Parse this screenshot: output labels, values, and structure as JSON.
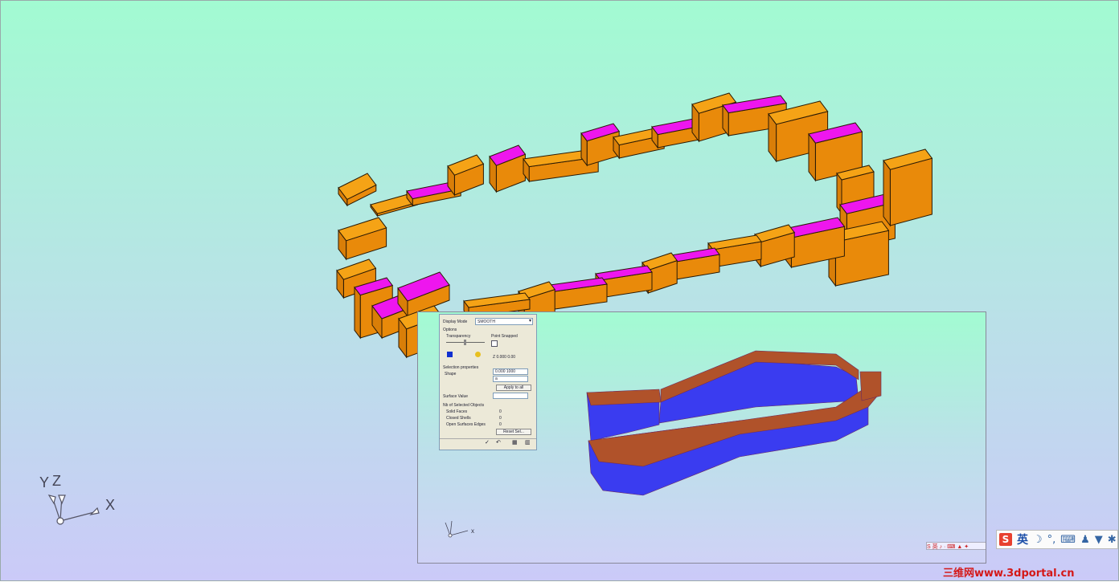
{
  "main_view": {
    "axis": {
      "x_label": "X",
      "y_label": "Y",
      "z_label": "Z"
    },
    "colors": {
      "box_orange": "#e98a0a",
      "box_orange_top": "#f5a316",
      "box_magenta_top": "#ee16ee",
      "edge": "#2a1a05"
    }
  },
  "inset": {
    "axis": {
      "x_label": "x"
    },
    "colors": {
      "wall_blue": "#3a3cf0",
      "wall_brown": "#b0522a"
    },
    "dialog": {
      "display_mode_label": "Display Mode",
      "display_mode_value": "SMOOTH",
      "options_label": "Options",
      "slider_label": "Transparency",
      "point_label": "Point Snapped",
      "coord_value": "Z  0.000  0.00",
      "selection_header": "Selection properties",
      "field1_label": "Shape",
      "field1_value": "0.000  1000",
      "field2_value": "a",
      "apply_label": "Apply to all",
      "surface_label": "Surface Value",
      "info_header": "Nb of Selected Objects",
      "info_rows": [
        {
          "label": "Solid Faces",
          "value": "0"
        },
        {
          "label": "Closed Shells",
          "value": "0"
        },
        {
          "label": "Open Surfaces Edges",
          "value": "0"
        }
      ],
      "reset_label": "Reset Sel..."
    },
    "tray_text": "S 英 ♪ · ⌨ ▲ ✦"
  },
  "ime_toolbar": {
    "logo": "S",
    "language": "英",
    "icons": [
      "moon-icon",
      "punctuation-icon",
      "keyboard-icon",
      "user-icon",
      "shirt-icon",
      "tools-icon"
    ]
  },
  "watermark": {
    "text": "三维网www.3dportal.cn"
  }
}
